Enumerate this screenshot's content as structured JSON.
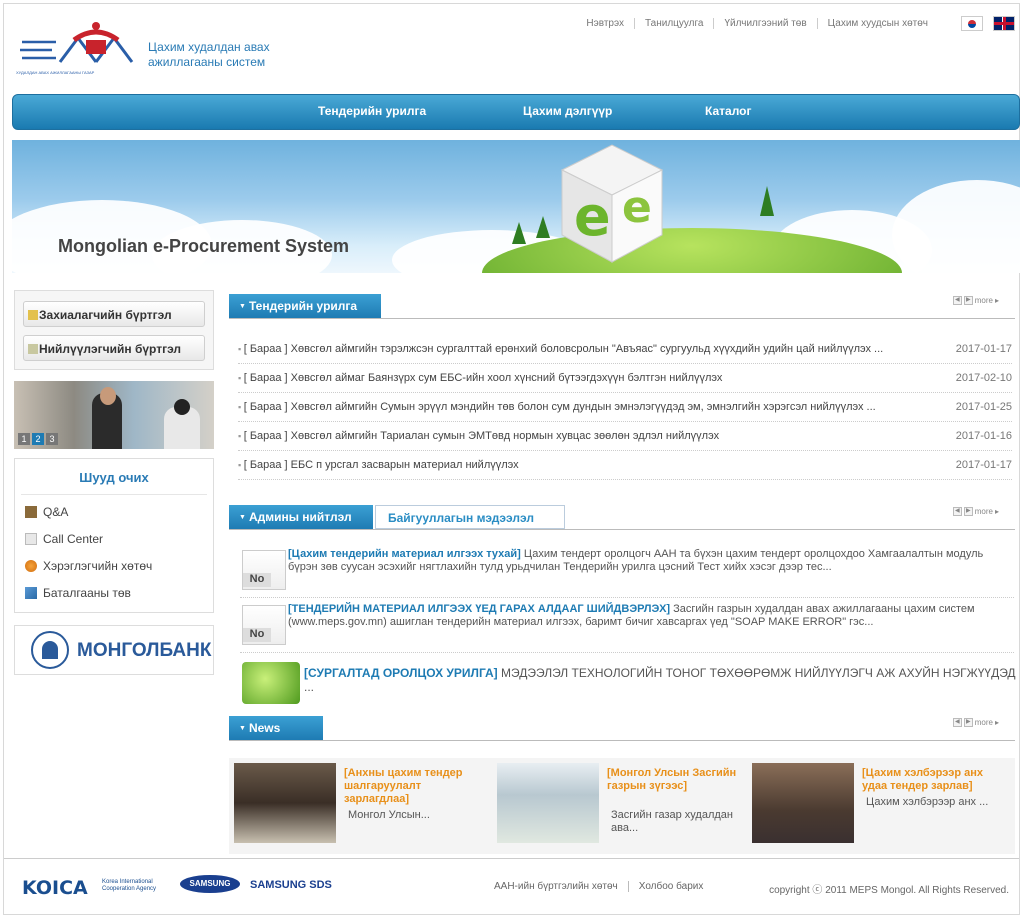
{
  "header": {
    "logo_text_line1": "Цахим худалдан авах",
    "logo_text_line2": "ажиллагааны систем",
    "logo_sub": "ХУДАЛДАН АВАХ АЖИЛЛАГААНЫ ГАЗАР",
    "top_links": [
      "Нэвтрэх",
      "Танилцуулга",
      "Үйлчилгээний төв",
      "Цахим хуудсын хөтөч"
    ],
    "flags": [
      "korea-flag-icon",
      "uk-flag-icon"
    ]
  },
  "nav": {
    "items": [
      "Тендерийн урилга",
      "Цахим дэлгүүр",
      "Каталог"
    ]
  },
  "banner": {
    "title": "Mongolian e-Procurement System"
  },
  "sidebar": {
    "customer_register": "Захиалагчийн бүртгэл",
    "supplier_register": "Нийлүүлэгчийн бүртгэл",
    "photo_pages": [
      "1",
      "2",
      "3"
    ],
    "shortcut_title": "Шууд очих",
    "shortcuts": [
      "Q&A",
      "Call Center",
      "Хэрэглэгчийн хөтөч",
      "Баталгааны төв"
    ],
    "bank_name": "МОНГОЛБАНК"
  },
  "tenders": {
    "tab": "Тендерийн урилга",
    "more": "more",
    "items": [
      {
        "title": "[ Бараа ] Хөвсгөл аймгийн тэрэлжсэн сургалттай ерөнхий боловсролын \"Авъяас\" сургуульд хүүхдийн удийн цай нийлүүлэх ...",
        "date": "2017-01-17"
      },
      {
        "title": "[ Бараа ] Хөвсгөл аймаг Баянзүрх сум ЕБС-ийн хоол хүнсний бүтээгдэхүүн бэлтгэн нийлүүлэх",
        "date": "2017-02-10"
      },
      {
        "title": "[ Бараа ] Хөвсгөл аймгийн Сумын эрүүл мэндийн төв болон сум дундын эмнэлэгүүдэд эм, эмнэлгийн хэрэгсэл нийлүүлэх ...",
        "date": "2017-01-25"
      },
      {
        "title": "[ Бараа ] Хөвсгөл аймгийн Тариалан сумын ЭМТөвд нормын хувцас зөөлөн эдлэл нийлүүлэх",
        "date": "2017-01-16"
      },
      {
        "title": "[ Бараа ] ЕБС п урсгал засварын материал нийлүүлэх",
        "date": "2017-01-17"
      }
    ]
  },
  "admin": {
    "tab_active": "Админы нийтлэл",
    "tab_inactive": "Байгууллагын мэдээлэл",
    "more": "more",
    "no_label": "No",
    "items": [
      {
        "title": "[Цахим тендерийн материал илгээх тухай]",
        "body": " Цахим тендерт оролцогч ААН та бүхэн цахим тендерт оролцохдоо Хамгаалалтын модуль бүрэн зөв суусан эсэхийг нягтлахийн тулд урьдчилан Тендерийн урилга цэсний Тест хийх хэсэг дээр тес..."
      },
      {
        "title": "[ТЕНДЕРИЙН МАТЕРИАЛ ИЛГЭЭХ ҮЕД ГАРАХ АЛДААГ ШИЙДВЭРЛЭХ]",
        "body": " Засгийн газрын худалдан авах ажиллагааны цахим систем (www.meps.gov.mn) ашиглан тендерийн материал илгээх, баримт бичиг хавсаргах үед \"SOAP MAKE ERROR\" гэс..."
      },
      {
        "title": "[СУРГАЛТАД ОРОЛЦОХ УРИЛГА]",
        "body": " МЭДЭЭЛЭЛ ТЕХНОЛОГИЙН ТОНОГ ТӨХӨӨРӨМЖ НИЙЛҮҮЛЭГЧ АЖ АХУЙН НЭГЖҮҮДЭД ..."
      }
    ]
  },
  "news": {
    "tab": "News",
    "more": "more",
    "items": [
      {
        "title": "[Анхны цахим тендер шалгаруулалт зарлагдлаа]",
        "body": "Монгол Улсын..."
      },
      {
        "title": "[Монгол Улсын Засгийн газрын зүгээс]",
        "body": "Засгийн газар худалдан ава..."
      },
      {
        "title": "[Цахим хэлбэрээр анх удаа тендер зарлав]",
        "body": "Цахим хэлбэрээр анх ..."
      }
    ]
  },
  "footer": {
    "koica": "KOICA",
    "koica_sub1": "Korea International",
    "koica_sub2": "Cooperation Agency",
    "samsung": "SAMSUNG",
    "samsung_sds": "SAMSUNG SDS",
    "links": [
      "ААН-ийн бүртгэлийн хөтөч",
      "Холбоо барих"
    ],
    "copyright": "copyright ⓒ 2011 MEPS Mongol. All Rights Reserved."
  }
}
